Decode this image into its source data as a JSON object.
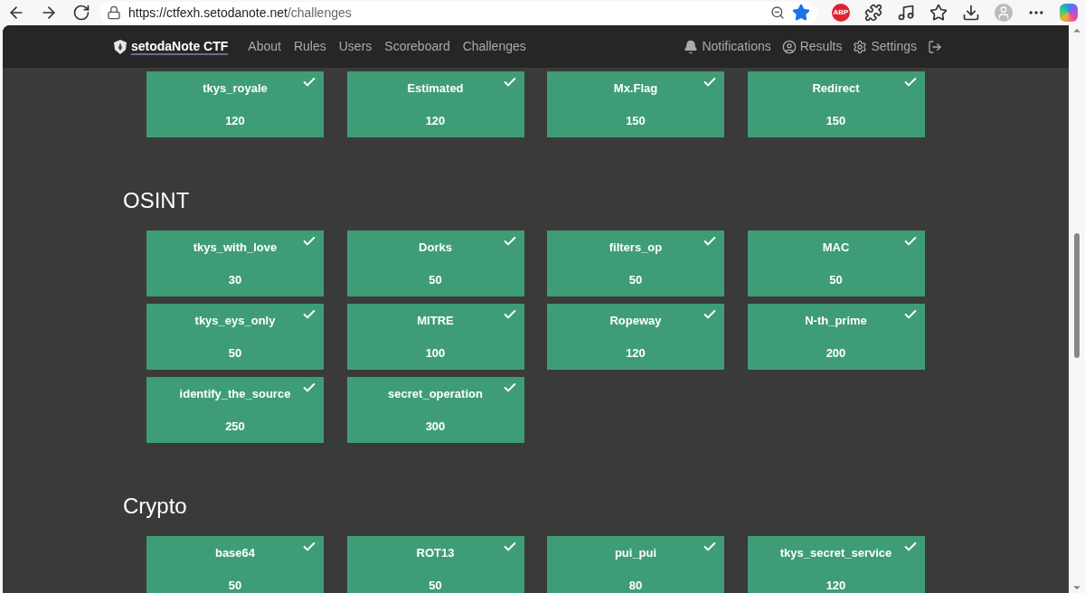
{
  "browser": {
    "url_host": "https://ctfexh.setodanote.net",
    "url_path": "/challenges",
    "extension_badge": "ABP",
    "bookmarked": true
  },
  "nav": {
    "brand": "setodaNote CTF",
    "links": [
      "About",
      "Rules",
      "Users",
      "Scoreboard",
      "Challenges"
    ],
    "right": [
      {
        "kind": "bell",
        "label": "Notifications"
      },
      {
        "kind": "user",
        "label": "Results"
      },
      {
        "kind": "gears",
        "label": "Settings"
      },
      {
        "kind": "logout"
      }
    ]
  },
  "sections": [
    {
      "challenges": [
        {
          "name": "tkys_royale",
          "points": "120",
          "solved": true
        },
        {
          "name": "Estimated",
          "points": "120",
          "solved": true
        },
        {
          "name": "Mx.Flag",
          "points": "150",
          "solved": true
        },
        {
          "name": "Redirect",
          "points": "150",
          "solved": true
        }
      ]
    },
    {
      "title": "OSINT",
      "challenges": [
        {
          "name": "tkys_with_love",
          "points": "30",
          "solved": true
        },
        {
          "name": "Dorks",
          "points": "50",
          "solved": true
        },
        {
          "name": "filters_op",
          "points": "50",
          "solved": true
        },
        {
          "name": "MAC",
          "points": "50",
          "solved": true
        },
        {
          "name": "tkys_eys_only",
          "points": "50",
          "solved": true
        },
        {
          "name": "MITRE",
          "points": "100",
          "solved": true
        },
        {
          "name": "Ropeway",
          "points": "120",
          "solved": true
        },
        {
          "name": "N-th_prime",
          "points": "200",
          "solved": true
        },
        {
          "name": "identify_the_source",
          "points": "250",
          "solved": true
        },
        {
          "name": "secret_operation",
          "points": "300",
          "solved": true
        }
      ]
    },
    {
      "title": "Crypto",
      "challenges": [
        {
          "name": "base64",
          "points": "50",
          "solved": true
        },
        {
          "name": "ROT13",
          "points": "50",
          "solved": true
        },
        {
          "name": "pui_pui",
          "points": "80",
          "solved": true
        },
        {
          "name": "tkys_secret_service",
          "points": "120",
          "solved": true
        }
      ]
    }
  ]
}
